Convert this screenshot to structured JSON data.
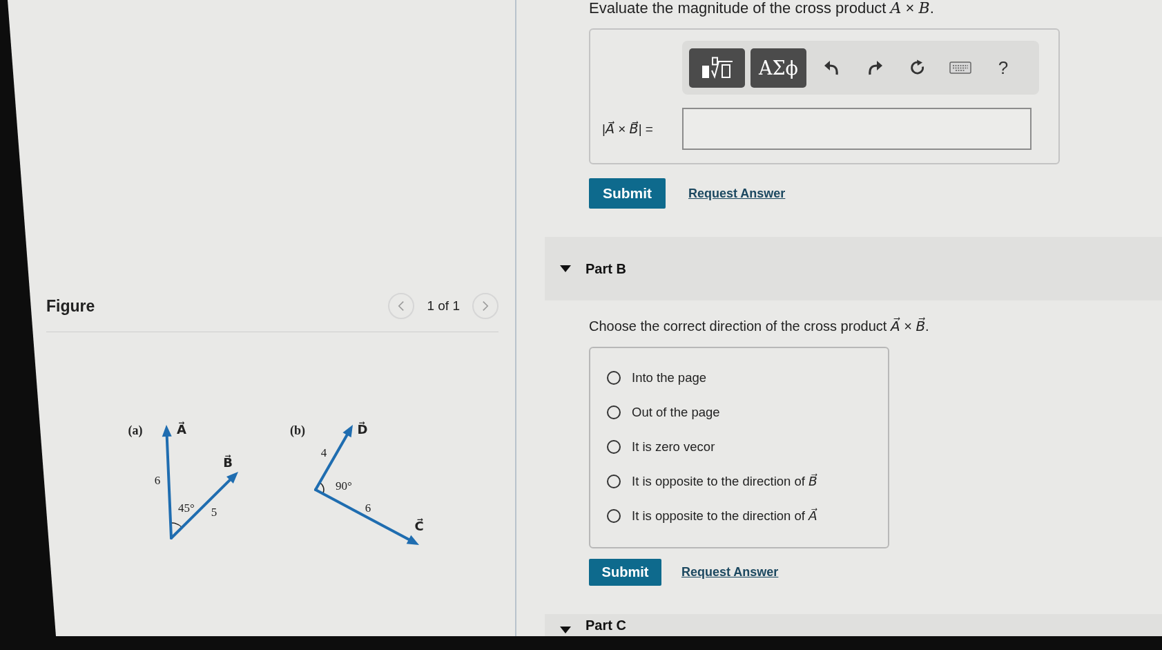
{
  "figure_panel": {
    "title": "Figure",
    "pager": {
      "text": "1 of 1",
      "prev_disabled": true,
      "next_disabled": true
    },
    "figures": [
      {
        "label": "(a)",
        "angle": "45°",
        "vectors": [
          {
            "name": "A⃗",
            "length": "6"
          },
          {
            "name": "B⃗",
            "length": "5"
          }
        ]
      },
      {
        "label": "(b)",
        "angle": "90°",
        "vectors": [
          {
            "name": "D⃗",
            "length": "4"
          },
          {
            "name": "C⃗",
            "length": "6"
          }
        ]
      }
    ]
  },
  "part_a": {
    "question": "Evaluate the magnitude of the cross product *A* × *B*.",
    "toolbar": {
      "symbols": "ΑΣϕ",
      "help": "?"
    },
    "answer_label": "|*A⃗* × *B⃗*| =",
    "submit": "Submit",
    "request": "Request Answer"
  },
  "part_b": {
    "title": "Part B",
    "expanded": true,
    "question": "Choose the correct direction of the cross product *A⃗* × *B⃗*.",
    "options": [
      {
        "label": "Into the page",
        "selected": false
      },
      {
        "label": "Out of the page",
        "selected": false
      },
      {
        "label": "It is zero vecor",
        "selected": false
      },
      {
        "label": "It is opposite to the direction of *B⃗*",
        "selected": false
      },
      {
        "label": "It is opposite to the direction of *A⃗*",
        "selected": false
      }
    ],
    "submit": "Submit",
    "request": "Request Answer"
  },
  "part_c": {
    "title": "Part C",
    "expanded": true
  }
}
